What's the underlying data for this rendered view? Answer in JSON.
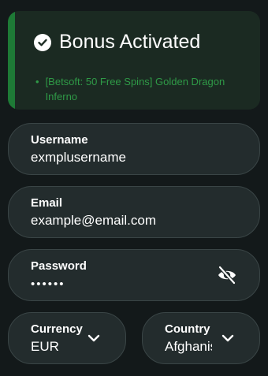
{
  "banner": {
    "title": "Bonus Activated",
    "bonus_item": "[Betsoft: 50 Free Spins] Golden Dragon Inferno",
    "icon": "check-circle-icon",
    "accent_color": "#1e7a36",
    "text_color": "#2f9a47"
  },
  "form": {
    "username": {
      "label": "Username",
      "value": "exmplusername"
    },
    "email": {
      "label": "Email",
      "value": "example@email.com"
    },
    "password": {
      "label": "Password",
      "value": "••••••",
      "toggle_icon": "eye-off-icon"
    },
    "currency": {
      "label": "Currency",
      "value": "EUR",
      "icon": "chevron-down-icon"
    },
    "country": {
      "label": "Country",
      "value": "Afghanistan",
      "icon": "chevron-down-icon"
    }
  }
}
